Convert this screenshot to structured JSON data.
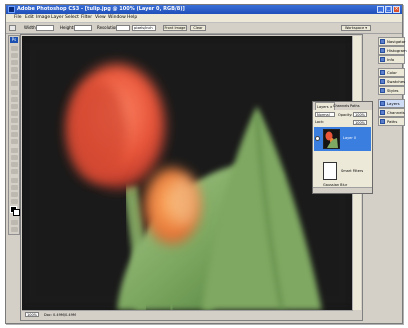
{
  "app": {
    "title": "Adobe Photoshop CS3 - [tulip.jpg @ 100% (Layer 0, RGB/8)]",
    "colors": {
      "titlebar": "#1f4fb8",
      "selection": "#3a7ee0",
      "panel": "#ece9d8"
    }
  },
  "menu": [
    "File",
    "Edit",
    "Image",
    "Layer",
    "Select",
    "Filter",
    "View",
    "Window",
    "Help"
  ],
  "options": {
    "tool_icon": "crop-icon",
    "width_label": "Width:",
    "width_value": "",
    "height_label": "Height:",
    "height_value": "",
    "resolution_label": "Resolution:",
    "resolution_value": "",
    "units_value": "pixels/inch",
    "front_image_label": "Front Image",
    "clear_label": "Clear",
    "workspace_label": "Workspace ▾"
  },
  "toolbox": {
    "logo": "Ps"
  },
  "document": {
    "zoom": "100%",
    "doc_info": "Doc: 0.49M/0.49M",
    "subject": "tulip-blurred-photo"
  },
  "dock": {
    "items": [
      {
        "label": "Navigator",
        "icon": "navigator-icon"
      },
      {
        "label": "Histogram",
        "icon": "histogram-icon"
      },
      {
        "label": "Info",
        "icon": "info-icon"
      },
      {
        "label": "Color",
        "icon": "color-icon"
      },
      {
        "label": "Swatches",
        "icon": "swatches-icon"
      },
      {
        "label": "Styles",
        "icon": "styles-icon"
      },
      {
        "label": "Layers",
        "icon": "layers-icon"
      },
      {
        "label": "Channels",
        "icon": "channels-icon"
      },
      {
        "label": "Paths",
        "icon": "paths-icon"
      }
    ]
  },
  "layers_panel": {
    "tabs": [
      "Layers ×",
      "Channels",
      "Paths"
    ],
    "blend_mode": "Normal",
    "opacity_label": "Opacity:",
    "opacity_value": "100%",
    "lock_label": "Lock:",
    "fill_value": "100%",
    "layer_name": "Layer 0",
    "smart_filters_label": "Smart Filters",
    "filter_name": "Gaussian Blur"
  }
}
